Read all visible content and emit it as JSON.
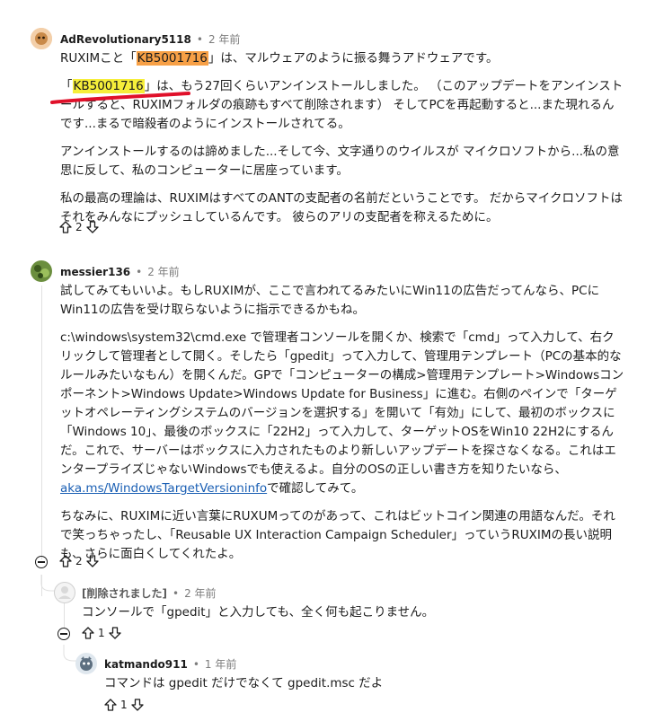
{
  "comments": [
    {
      "username": "AdRevolutionary5118",
      "time": "2 年前",
      "paragraphs": [
        [
          "RUXIMこと「",
          "KB5001716",
          "」は、マルウェアのように振る舞うアドウェアです。"
        ],
        [
          "「",
          "KB5001716",
          "」は、もう27回くらいアンインストールしました。 （このアップデートをアンインストールすると、RUXIMフォルダの痕跡もすべて削除されます） そしてPCを再起動すると...また現れるんです...まるで暗殺者のようにインストールされてる。"
        ],
        "アンインストールするのは諦めました...そして今、文字通りのウイルスが マイクロソフトから...私の意思に反して、私のコンピューターに居座っています。",
        "私の最高の理論は、RUXIMはすべてのANTの支配者の名前だということです。 だからマイクロソフトはそれをみんなにプッシュしているんです。 彼らのアリの支配者を称えるために。"
      ],
      "votes": "2"
    },
    {
      "username": "messier136",
      "time": "2 年前",
      "paragraphs": [
        "試してみてもいいよ。もしRUXIMが、ここで言われてるみたいにWin11の広告だってんなら、PCにWin11の広告を受け取らないように指示できるかもね。",
        "c:\\windows\\system32\\cmd.exe で管理者コンソールを開くか、検索で「cmd」って入力して、右クリックして管理者として開く。そしたら「gpedit」って入力して、管理用テンプレート（PCの基本的なルールみたいなもん）を開くんだ。GPで「コンピューターの構成>管理用テンプレート>Windowsコンポーネント>Windows Update>Windows Update for Business」に進む。右側のペインで「ターゲットオペレーティングシステムのバージョンを選択する」を開いて「有効」にして、最初のボックスに「Windows 10」、最後のボックスに「22H2」って入力して、ターゲットOSをWin10 22H2にするんだ。これで、サーバーはボックスに入力されたものより新しいアップデートを探さなくなる。これはエンタープライズじゃないWindowsでも使えるよ。自分のOSの正しい書き方を知りたいなら、",
        "ちなみに、RUXIMに近い言葉にRUXUMってのがあって、これはビットコイン関連の用語なんだ。それで笑っちゃったし、「Reusable UX Interaction Campaign Scheduler」っていうRUXIMの長い説明も、さらに面白くしてくれたよ。"
      ],
      "link_text": "aka.ms/WindowsTargetVersioninfo",
      "after_link": "で確認してみて。",
      "votes": "2"
    },
    {
      "username": "[削除されました]",
      "time": "2 年前",
      "text": "コンソールで「gpedit」と入力しても、全く何も起こりません。",
      "votes": "1"
    },
    {
      "username": "katmando911",
      "time": "1 年前",
      "text": "コマンドは gpedit だけでなくて gpedit.msc だよ",
      "votes": "1"
    }
  ],
  "separator": "•",
  "colors": {
    "highlight_orange": "#f7a046",
    "highlight_yellow": "#f6ee3a",
    "annotation_red": "#e0102a",
    "link": "#1a5fb4"
  }
}
